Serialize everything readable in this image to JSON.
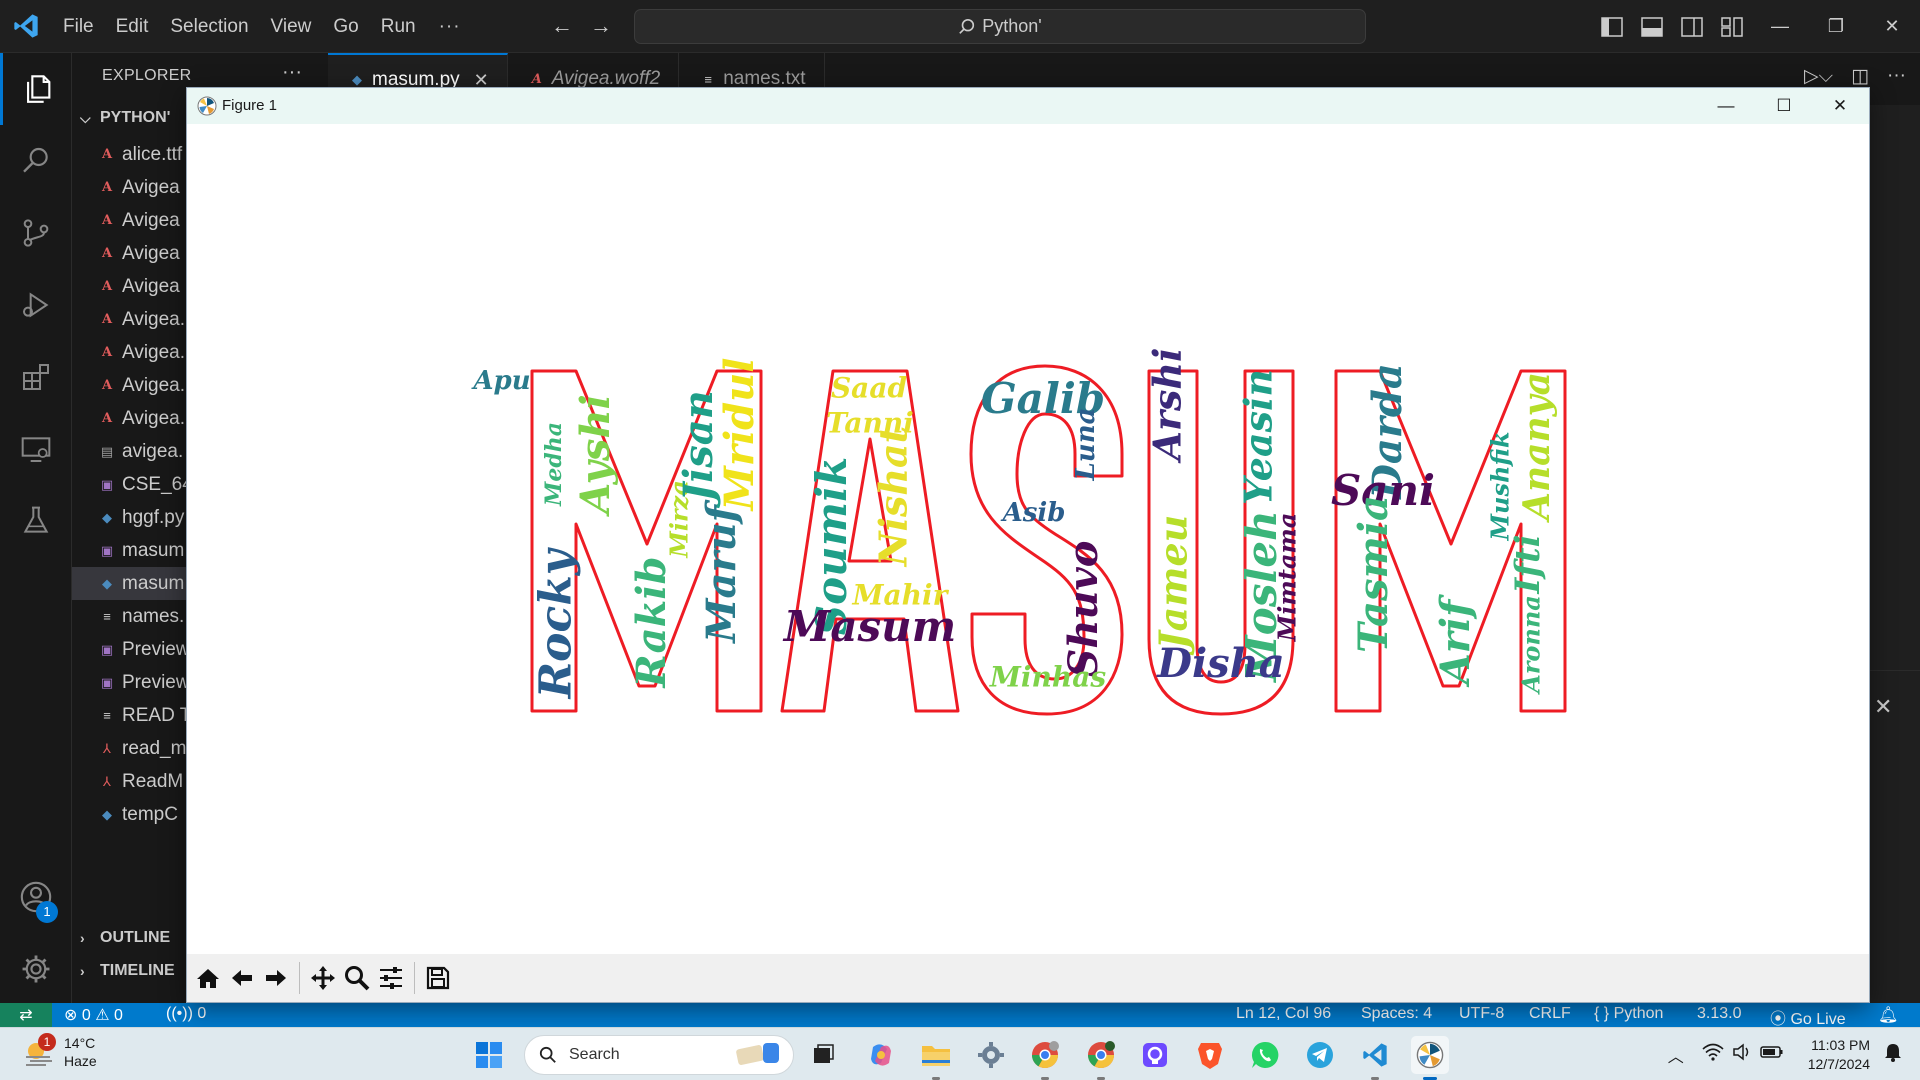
{
  "menu": {
    "items": [
      "File",
      "Edit",
      "Selection",
      "View",
      "Go",
      "Run"
    ],
    "more": "···"
  },
  "command_center": {
    "text": "Python'"
  },
  "explorer": {
    "header": "EXPLORER",
    "more": "···",
    "folder": "PYTHON'",
    "files": [
      {
        "name": "alice.ttf",
        "icon": "font-file-icon",
        "kind": "font"
      },
      {
        "name": "Avigea",
        "icon": "font-file-icon",
        "kind": "font"
      },
      {
        "name": "Avigea",
        "icon": "font-file-icon",
        "kind": "font"
      },
      {
        "name": "Avigea",
        "icon": "font-file-icon",
        "kind": "font"
      },
      {
        "name": "Avigea",
        "icon": "font-file-icon",
        "kind": "font"
      },
      {
        "name": "Avigea.",
        "icon": "font-file-icon",
        "kind": "font"
      },
      {
        "name": "Avigea.",
        "icon": "font-file-icon",
        "kind": "font"
      },
      {
        "name": "Avigea.",
        "icon": "font-file-icon",
        "kind": "font"
      },
      {
        "name": "Avigea.",
        "icon": "font-file-icon",
        "kind": "font"
      },
      {
        "name": "avigea.",
        "icon": "file-icon",
        "kind": "file"
      },
      {
        "name": "CSE_64",
        "icon": "image-file-icon",
        "kind": "img"
      },
      {
        "name": "hggf.py",
        "icon": "python-file-icon",
        "kind": "py"
      },
      {
        "name": "masum",
        "icon": "image-file-icon",
        "kind": "img"
      },
      {
        "name": "masum",
        "icon": "python-file-icon",
        "kind": "py",
        "selected": true
      },
      {
        "name": "names.",
        "icon": "text-file-icon",
        "kind": "txt"
      },
      {
        "name": "Preview",
        "icon": "image-file-icon",
        "kind": "img"
      },
      {
        "name": "Preview",
        "icon": "image-file-icon",
        "kind": "img"
      },
      {
        "name": "READ T",
        "icon": "text-file-icon",
        "kind": "txt"
      },
      {
        "name": "read_m",
        "icon": "pdf-file-icon",
        "kind": "pdf"
      },
      {
        "name": "ReadM",
        "icon": "pdf-file-icon",
        "kind": "pdf"
      },
      {
        "name": "tempC",
        "icon": "python-file-icon",
        "kind": "py"
      }
    ],
    "outline": "OUTLINE",
    "timeline": "TIMELINE"
  },
  "tabs": [
    {
      "label": "masum.py",
      "active": true,
      "icon": "python-file-icon"
    },
    {
      "label": "Avigea.woff2",
      "active": false,
      "icon": "font-file-icon"
    },
    {
      "label": "names.txt",
      "active": false,
      "icon": "text-file-icon"
    }
  ],
  "activity": {
    "accounts_badge": "1"
  },
  "figure": {
    "title": "Figure 1",
    "wordcloud_word": "MASUM",
    "word_colors": [
      "#2a7b8c",
      "#3bb57a",
      "#e6de2a",
      "#3b2a7a",
      "#4d0a57",
      "#7fd24a",
      "#1f9f88"
    ],
    "outline_color": "#ee1c24",
    "words": [
      {
        "text": "Apu",
        "color": "#2a7b8c"
      },
      {
        "text": "Medha",
        "color": "#3bb57a"
      },
      {
        "text": "Ayshi",
        "color": "#7fd24a"
      },
      {
        "text": "Rocky",
        "color": "#2a5d8c"
      },
      {
        "text": "Rakib",
        "color": "#3bb57a"
      },
      {
        "text": "Mirza",
        "color": "#b6de2a"
      },
      {
        "text": "Jisan",
        "color": "#1f9f88"
      },
      {
        "text": "Mridul",
        "color": "#f0e31a"
      },
      {
        "text": "Maruf",
        "color": "#2a7b8c"
      },
      {
        "text": "Saad",
        "color": "#e6de2a"
      },
      {
        "text": "Tanni",
        "color": "#e6de2a"
      },
      {
        "text": "Soumik",
        "color": "#1f9f88"
      },
      {
        "text": "Nishat",
        "color": "#e6de2a"
      },
      {
        "text": "Mahir",
        "color": "#e6de2a"
      },
      {
        "text": "Masum",
        "color": "#4d0a57"
      },
      {
        "text": "Galib",
        "color": "#2a7b8c"
      },
      {
        "text": "Luna",
        "color": "#2a5d8c"
      },
      {
        "text": "Asib",
        "color": "#2a5d8c"
      },
      {
        "text": "Shuvo",
        "color": "#4d0a57"
      },
      {
        "text": "Minhas",
        "color": "#7fd24a"
      },
      {
        "text": "Arshi",
        "color": "#3b2a7a"
      },
      {
        "text": "Yeasin",
        "color": "#1f9f88"
      },
      {
        "text": "Jameu",
        "color": "#b6de2a"
      },
      {
        "text": "Mosleh",
        "color": "#3bb57a"
      },
      {
        "text": "Mimtama",
        "color": "#4d0a57"
      },
      {
        "text": "Disha",
        "color": "#3b3a8a"
      },
      {
        "text": "Darda",
        "color": "#2a7b8c"
      },
      {
        "text": "Sani",
        "color": "#4d0a57"
      },
      {
        "text": "Tasmia",
        "color": "#3bb57a"
      },
      {
        "text": "Arif",
        "color": "#3bb57a"
      },
      {
        "text": "Mushfik",
        "color": "#1f9f88"
      },
      {
        "text": "Ananya",
        "color": "#b6de2a"
      },
      {
        "text": "Ifti",
        "color": "#3bb57a"
      },
      {
        "text": "Aronna",
        "color": "#3bb57a"
      }
    ]
  },
  "statusbar": {
    "remote_icon": "remote-icon",
    "errors": "0",
    "warnings": "0",
    "ports": "0",
    "position": "Ln 12, Col 96",
    "spaces": "Spaces: 4",
    "encoding": "UTF-8",
    "eol": "CRLF",
    "language": "{ } Python",
    "python_version": "3.13.0",
    "golive": "Go Live"
  },
  "taskbar": {
    "weather_temp": "14°C",
    "weather_desc": "Haze",
    "weather_badge": "1",
    "search_placeholder": "Search",
    "time": "11:03 PM",
    "date": "12/7/2024"
  }
}
